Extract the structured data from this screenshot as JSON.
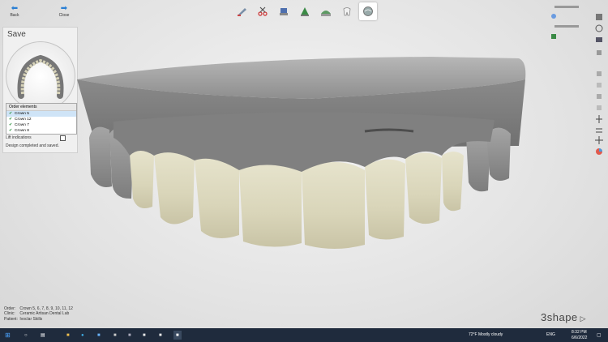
{
  "toolbar": {
    "back_label": "Back",
    "close_label": "Close"
  },
  "panel": {
    "title": "Save",
    "order_header": "Order elements",
    "items": [
      "Crown 5",
      "Crown 12",
      "Crown 7",
      "Crown 8"
    ],
    "lift_label": "Lift indications",
    "status": "Design completed and saved."
  },
  "order_info": {
    "order_key": "Order:",
    "order_val": "Crown 5, 6, 7, 8, 9, 10, 11, 12",
    "clinic_key": "Clinic:",
    "clinic_val": "Ceramic Artisan Dental Lab",
    "patient_key": "Patient:",
    "patient_val": "Ivoclar Skills"
  },
  "logo": "3shape",
  "taskbar": {
    "weather": "72°F  Mostly cloudy",
    "lang": "ENG",
    "time": "8:32 PM",
    "date": "6/6/2022"
  },
  "colors": {
    "model_gray": "#8a8a8a",
    "crown_ivory": "#dcd8bf",
    "taskbar": "#1f2b3d",
    "accent_blue": "#2a7fd4"
  }
}
